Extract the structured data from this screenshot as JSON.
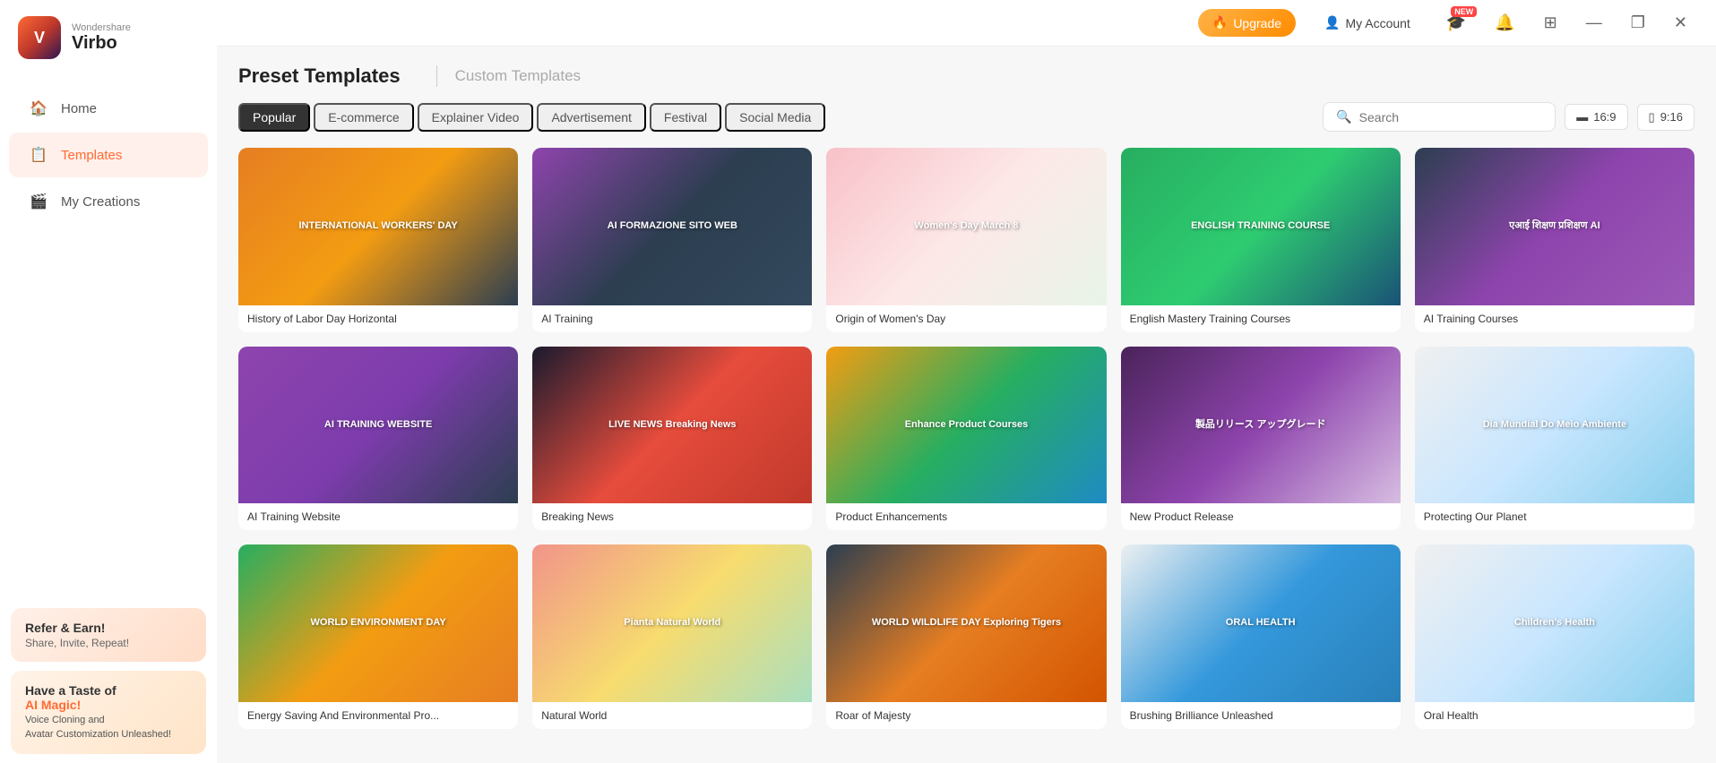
{
  "app": {
    "brand": "Wondershare",
    "name": "Virbo"
  },
  "topbar": {
    "upgrade_label": "Upgrade",
    "account_label": "My Account",
    "ratio_16_9": "16:9",
    "ratio_9_16": "9:16",
    "new_badge": "NEW"
  },
  "sidebar": {
    "nav": [
      {
        "id": "home",
        "label": "Home",
        "icon": "🏠",
        "active": false
      },
      {
        "id": "templates",
        "label": "Templates",
        "icon": "📋",
        "active": true
      },
      {
        "id": "my-creations",
        "label": "My Creations",
        "icon": "🎬",
        "active": false
      }
    ],
    "promo1": {
      "title": "Refer & Earn!",
      "subtitle": "Share, Invite, Repeat!"
    },
    "promo2": {
      "line1": "Have a Taste of",
      "ai_text": "AI Magic!",
      "subtitle": "Voice Cloning and\nAvatar Customization Unleashed!"
    }
  },
  "page": {
    "title": "Preset Templates",
    "custom_label": "Custom Templates"
  },
  "filters": {
    "tabs": [
      {
        "id": "popular",
        "label": "Popular",
        "active": true
      },
      {
        "id": "ecommerce",
        "label": "E-commerce",
        "active": false
      },
      {
        "id": "explainer",
        "label": "Explainer Video",
        "active": false
      },
      {
        "id": "advertisement",
        "label": "Advertisement",
        "active": false
      },
      {
        "id": "festival",
        "label": "Festival",
        "active": false
      },
      {
        "id": "social",
        "label": "Social Media",
        "active": false
      }
    ],
    "search_placeholder": "Search"
  },
  "templates": [
    {
      "id": 1,
      "label": "History of Labor Day Horizontal",
      "thumb_class": "thumb-1",
      "thumb_text": "INTERNATIONAL WORKERS' DAY"
    },
    {
      "id": 2,
      "label": "AI Training",
      "thumb_class": "thumb-2",
      "thumb_text": "AI FORMAZIONE SITO WEB"
    },
    {
      "id": 3,
      "label": "Origin of Women's Day",
      "thumb_class": "thumb-3",
      "thumb_text": "Women's Day March 8"
    },
    {
      "id": 4,
      "label": "English Mastery Training Courses",
      "thumb_class": "thumb-4",
      "thumb_text": "ENGLISH TRAINING COURSE"
    },
    {
      "id": 5,
      "label": "AI Training Courses",
      "thumb_class": "thumb-5",
      "thumb_text": "एआई शिक्षण प्रशिक्षण AI"
    },
    {
      "id": 6,
      "label": "AI Training Website",
      "thumb_class": "thumb-7",
      "thumb_text": "AI TRAINING WEBSITE"
    },
    {
      "id": 7,
      "label": "Breaking News",
      "thumb_class": "thumb-6",
      "thumb_text": "LIVE NEWS Breaking News"
    },
    {
      "id": 8,
      "label": "Product Enhancements",
      "thumb_class": "thumb-8",
      "thumb_text": "Enhance Product Courses"
    },
    {
      "id": 9,
      "label": "New Product Release",
      "thumb_class": "thumb-9",
      "thumb_text": "製品リリース アップグレード"
    },
    {
      "id": 10,
      "label": "Protecting Our Planet",
      "thumb_class": "thumb-12",
      "thumb_text": "Dia Mundial Do Meio Ambiente"
    },
    {
      "id": 11,
      "label": "Energy Saving And Environmental Pro...",
      "thumb_class": "thumb-11",
      "thumb_text": "WORLD ENVIRONMENT DAY"
    },
    {
      "id": 12,
      "label": "Natural World",
      "thumb_class": "thumb-13",
      "thumb_text": "Pianta Natural World"
    },
    {
      "id": 13,
      "label": "Roar of Majesty",
      "thumb_class": "thumb-14",
      "thumb_text": "WORLD WILDLIFE DAY Exploring Tigers"
    },
    {
      "id": 14,
      "label": "Brushing Brilliance Unleashed",
      "thumb_class": "thumb-15",
      "thumb_text": "ORAL HEALTH"
    },
    {
      "id": 15,
      "label": "Oral Health",
      "thumb_class": "thumb-12",
      "thumb_text": "Children's Health"
    }
  ]
}
